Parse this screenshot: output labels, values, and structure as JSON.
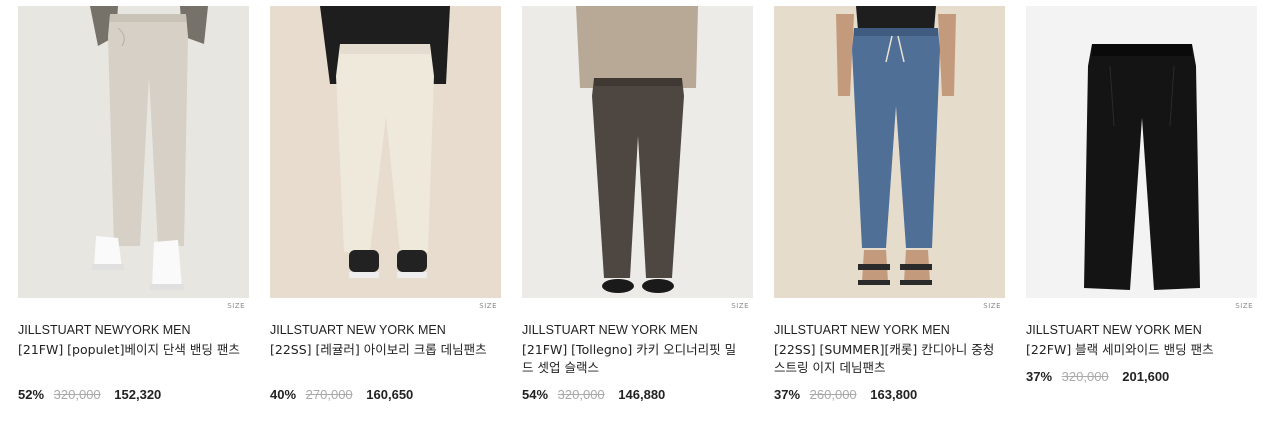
{
  "products": [
    {
      "brand": "JILLSTUART NEWYORK MEN",
      "name": "[21FW] [populet]베이지 단색 밴딩 팬츠",
      "size_label": "SIZE",
      "discount": "52%",
      "original_price": "320,000",
      "sale_price": "152,320",
      "bg_color": "#e8e6e1",
      "pants_color": "#d6d0c6"
    },
    {
      "brand": "JILLSTUART NEW YORK MEN",
      "name": "[22SS] [레귤러] 아이보리 크롭 데님팬츠",
      "size_label": "SIZE",
      "discount": "40%",
      "original_price": "270,000",
      "sale_price": "160,650",
      "bg_color": "#e7dccd",
      "pants_color": "#efe9dc"
    },
    {
      "brand": "JILLSTUART NEW YORK MEN",
      "name": "[21FW] [Tollegno] 카키 오디너리핏 밀드 셋업 슬랙스",
      "size_label": "SIZE",
      "discount": "54%",
      "original_price": "320,000",
      "sale_price": "146,880",
      "bg_color": "#ecebe8",
      "pants_color": "#4e4640"
    },
    {
      "brand": "JILLSTUART NEW YORK MEN",
      "name": "[22SS] [SUMMER][캐롯] 칸디아니 중청 스트링 이지 데님팬츠",
      "size_label": "SIZE",
      "discount": "37%",
      "original_price": "260,000",
      "sale_price": "163,800",
      "bg_color": "#e6dccc",
      "pants_color": "#4f6f96"
    },
    {
      "brand": "JILLSTUART NEW YORK MEN",
      "name": "[22FW] 블랙 세미와이드 밴딩 팬츠",
      "size_label": "SIZE",
      "discount": "37%",
      "original_price": "320,000",
      "sale_price": "201,600",
      "bg_color": "#f3f3f3",
      "pants_color": "#141414"
    }
  ]
}
